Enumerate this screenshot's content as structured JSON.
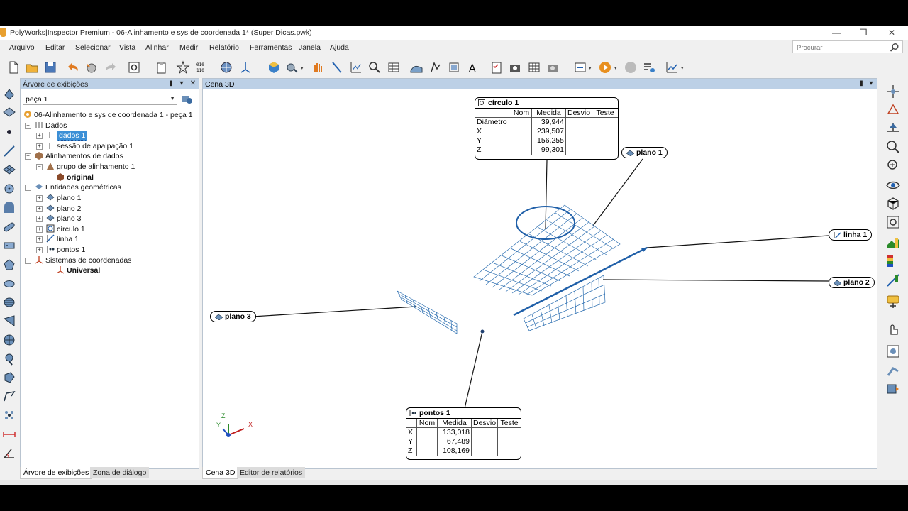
{
  "window": {
    "title": "PolyWorks|Inspector Premium - 06-Alinhamento e sys de coordenada 1* (Super Dicas.pwk)",
    "minimize": "—",
    "restore": "❐",
    "close": "✕"
  },
  "menu": [
    "Arquivo",
    "Editar",
    "Selecionar",
    "Vista",
    "Alinhar",
    "Medir",
    "Relatório",
    "Ferramentas",
    "Janela",
    "Ajuda"
  ],
  "search": {
    "placeholder": "Procurar"
  },
  "tree_panel": {
    "title": "Árvore de exibições",
    "combo_value": "peça 1",
    "rows": [
      "06-Alinhamento e sys de coordenada 1 - peça 1",
      "Dados",
      "dados 1",
      "sessão de apalpação 1",
      "Alinhamentos de dados",
      "grupo de alinhamento 1",
      "original",
      "Entidades geométricas",
      "plano 1",
      "plano 2",
      "plano 3",
      "círculo 1",
      "linha 1",
      "pontos 1",
      "Sistemas de coordenadas",
      "Universal"
    ],
    "tabs": [
      "Árvore de exibições",
      "Zona de diálogo"
    ]
  },
  "scene": {
    "title": "Cena 3D",
    "tabs": [
      "Cena 3D",
      "Editor de relatórios"
    ],
    "axes": {
      "x": "X",
      "y": "Y",
      "z": "Z"
    },
    "circle_callout": {
      "title": "círculo 1",
      "headers": [
        "",
        "Nom",
        "Medida",
        "Desvio",
        "Teste"
      ],
      "rows": [
        [
          "Diâmetro",
          "",
          "39,944",
          "",
          ""
        ],
        [
          "X",
          "",
          "239,507",
          "",
          ""
        ],
        [
          "Y",
          "",
          "156,255",
          "",
          ""
        ],
        [
          "Z",
          "",
          "99,301",
          "",
          ""
        ]
      ]
    },
    "points_callout": {
      "title": "pontos 1",
      "headers": [
        "",
        "Nom",
        "Medida",
        "Desvio",
        "Teste"
      ],
      "rows": [
        [
          "X",
          "",
          "133,018",
          "",
          ""
        ],
        [
          "Y",
          "",
          "67,489",
          "",
          ""
        ],
        [
          "Z",
          "",
          "108,169",
          "",
          ""
        ]
      ]
    },
    "labels": {
      "plano1": "plano 1",
      "plano2": "plano 2",
      "plano3": "plano 3",
      "linha1": "linha 1"
    },
    "colors": {
      "mesh": "#2a6db0",
      "line": "#1f5fa8",
      "header": "#bcd0e6"
    }
  }
}
